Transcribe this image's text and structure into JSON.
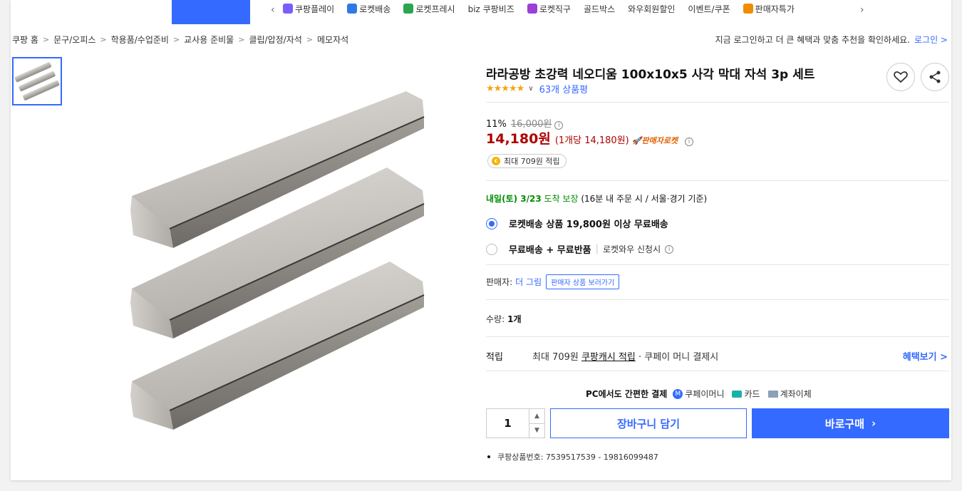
{
  "topnav": {
    "items": [
      {
        "label": "쿠팡플레이",
        "icon": "play-icon",
        "color": "#7b5cff"
      },
      {
        "label": "로켓배송",
        "icon": "rocket-icon",
        "color": "#2c7be5"
      },
      {
        "label": "로켓프레시",
        "icon": "rocket-fresh-icon",
        "color": "#2da44e"
      },
      {
        "label": "biz 쿠팡비즈",
        "icon": "biz-icon",
        "color": "#333333"
      },
      {
        "label": "로켓직구",
        "icon": "rocket-global-icon",
        "color": "#9b3fd6"
      },
      {
        "label": "골드박스",
        "icon": "goldbox-icon",
        "color": "#ffffff"
      },
      {
        "label": "와우회원할인",
        "icon": "wow-icon",
        "color": "#ffffff"
      },
      {
        "label": "이벤트/쿠폰",
        "icon": "coupon-icon",
        "color": "#ffffff"
      },
      {
        "label": "판매자특가",
        "icon": "seller-deal-icon",
        "color": "#f08c00"
      }
    ]
  },
  "breadcrumb": [
    "쿠팡 홈",
    "문구/오피스",
    "학용품/수업준비",
    "교사용 준비물",
    "클립/압정/자석",
    "메모자석"
  ],
  "login_prompt": {
    "text": "지금 로그인하고 더 큰 혜택과 맞춤 추천을 확인하세요.",
    "link": "로그인 >"
  },
  "product": {
    "title": "라라공방 초강력 네오디움 100x10x5 사각 막대 자석 3p 세트",
    "stars": "★★★★★",
    "rating": 4.5,
    "review_count": "63개 상품평",
    "discount_rate": "11%",
    "original_price": "16,000원",
    "price": "14,180원",
    "unit_price": "(1개당 14,180원)",
    "seller_rocket": "판매자로켓",
    "points_badge": "최대 709원 적립"
  },
  "delivery": {
    "date_bold": "내일(토) 3/23",
    "date_suffix": "도착 보장",
    "condition": "(16분  내 주문 시 / 서울⋅경기 기준)",
    "options": [
      {
        "label": "로켓배송 상품 19,800원 이상 무료배송",
        "selected": true
      },
      {
        "label": "무료배송 + 무료반품",
        "extra": "로켓와우 신청시",
        "selected": false
      }
    ]
  },
  "seller": {
    "label": "판매자:",
    "name": "더 그림",
    "button": "판매자 상품 보러가기"
  },
  "quantity": {
    "label": "수량:",
    "value_text": "1개",
    "stepper_value": "1"
  },
  "benefit": {
    "label": "적립",
    "prefix": "최대 709원",
    "link": "쿠팡캐시 적립",
    "suffix": "· 쿠페이 머니 결제시",
    "more": "혜택보기 >"
  },
  "payment": {
    "heading": "PC에서도 간편한 결제",
    "methods": [
      "쿠페이머니",
      "카드",
      "계좌이체"
    ]
  },
  "actions": {
    "cart": "장바구니 담기",
    "buy": "바로구매"
  },
  "product_number": "쿠팡상품번호: 7539517539 - 19816099487",
  "colors": {
    "accent": "#346aff",
    "price": "#ae0000",
    "delivery": "#008c00",
    "star": "#f7a414"
  }
}
